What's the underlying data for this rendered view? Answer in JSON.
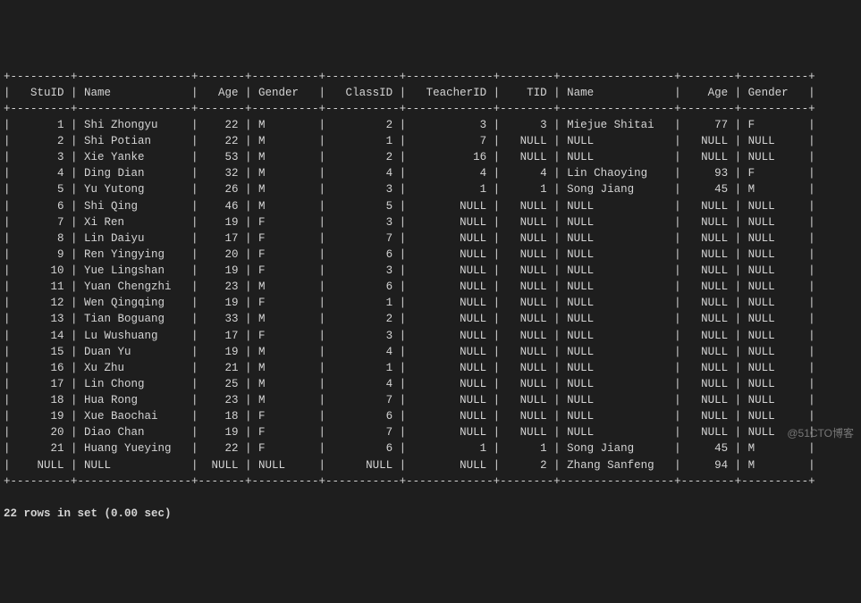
{
  "columns": [
    "StuID",
    "Name",
    "Age",
    "Gender",
    "ClassID",
    "TeacherID",
    "TID",
    "Name",
    "Age",
    "Gender"
  ],
  "rows": [
    [
      "1",
      "Shi Zhongyu",
      "22",
      "M",
      "2",
      "3",
      "3",
      "Miejue Shitai",
      "77",
      "F"
    ],
    [
      "2",
      "Shi Potian",
      "22",
      "M",
      "1",
      "7",
      "NULL",
      "NULL",
      "NULL",
      "NULL"
    ],
    [
      "3",
      "Xie Yanke",
      "53",
      "M",
      "2",
      "16",
      "NULL",
      "NULL",
      "NULL",
      "NULL"
    ],
    [
      "4",
      "Ding Dian",
      "32",
      "M",
      "4",
      "4",
      "4",
      "Lin Chaoying",
      "93",
      "F"
    ],
    [
      "5",
      "Yu Yutong",
      "26",
      "M",
      "3",
      "1",
      "1",
      "Song Jiang",
      "45",
      "M"
    ],
    [
      "6",
      "Shi Qing",
      "46",
      "M",
      "5",
      "NULL",
      "NULL",
      "NULL",
      "NULL",
      "NULL"
    ],
    [
      "7",
      "Xi Ren",
      "19",
      "F",
      "3",
      "NULL",
      "NULL",
      "NULL",
      "NULL",
      "NULL"
    ],
    [
      "8",
      "Lin Daiyu",
      "17",
      "F",
      "7",
      "NULL",
      "NULL",
      "NULL",
      "NULL",
      "NULL"
    ],
    [
      "9",
      "Ren Yingying",
      "20",
      "F",
      "6",
      "NULL",
      "NULL",
      "NULL",
      "NULL",
      "NULL"
    ],
    [
      "10",
      "Yue Lingshan",
      "19",
      "F",
      "3",
      "NULL",
      "NULL",
      "NULL",
      "NULL",
      "NULL"
    ],
    [
      "11",
      "Yuan Chengzhi",
      "23",
      "M",
      "6",
      "NULL",
      "NULL",
      "NULL",
      "NULL",
      "NULL"
    ],
    [
      "12",
      "Wen Qingqing",
      "19",
      "F",
      "1",
      "NULL",
      "NULL",
      "NULL",
      "NULL",
      "NULL"
    ],
    [
      "13",
      "Tian Boguang",
      "33",
      "M",
      "2",
      "NULL",
      "NULL",
      "NULL",
      "NULL",
      "NULL"
    ],
    [
      "14",
      "Lu Wushuang",
      "17",
      "F",
      "3",
      "NULL",
      "NULL",
      "NULL",
      "NULL",
      "NULL"
    ],
    [
      "15",
      "Duan Yu",
      "19",
      "M",
      "4",
      "NULL",
      "NULL",
      "NULL",
      "NULL",
      "NULL"
    ],
    [
      "16",
      "Xu Zhu",
      "21",
      "M",
      "1",
      "NULL",
      "NULL",
      "NULL",
      "NULL",
      "NULL"
    ],
    [
      "17",
      "Lin Chong",
      "25",
      "M",
      "4",
      "NULL",
      "NULL",
      "NULL",
      "NULL",
      "NULL"
    ],
    [
      "18",
      "Hua Rong",
      "23",
      "M",
      "7",
      "NULL",
      "NULL",
      "NULL",
      "NULL",
      "NULL"
    ],
    [
      "19",
      "Xue Baochai",
      "18",
      "F",
      "6",
      "NULL",
      "NULL",
      "NULL",
      "NULL",
      "NULL"
    ],
    [
      "20",
      "Diao Chan",
      "19",
      "F",
      "7",
      "NULL",
      "NULL",
      "NULL",
      "NULL",
      "NULL"
    ],
    [
      "21",
      "Huang Yueying",
      "22",
      "F",
      "6",
      "1",
      "1",
      "Song Jiang",
      "45",
      "M"
    ],
    [
      "NULL",
      "NULL",
      "NULL",
      "NULL",
      "NULL",
      "NULL",
      "2",
      "Zhang Sanfeng",
      "94",
      "M"
    ]
  ],
  "footer": "22 rows in set (0.00 sec)",
  "watermark": "@51CTO博客",
  "widths": [
    7,
    15,
    5,
    8,
    9,
    11,
    6,
    15,
    6,
    8
  ],
  "align": [
    "R",
    "L",
    "R",
    "L",
    "R",
    "R",
    "R",
    "L",
    "R",
    "L"
  ]
}
